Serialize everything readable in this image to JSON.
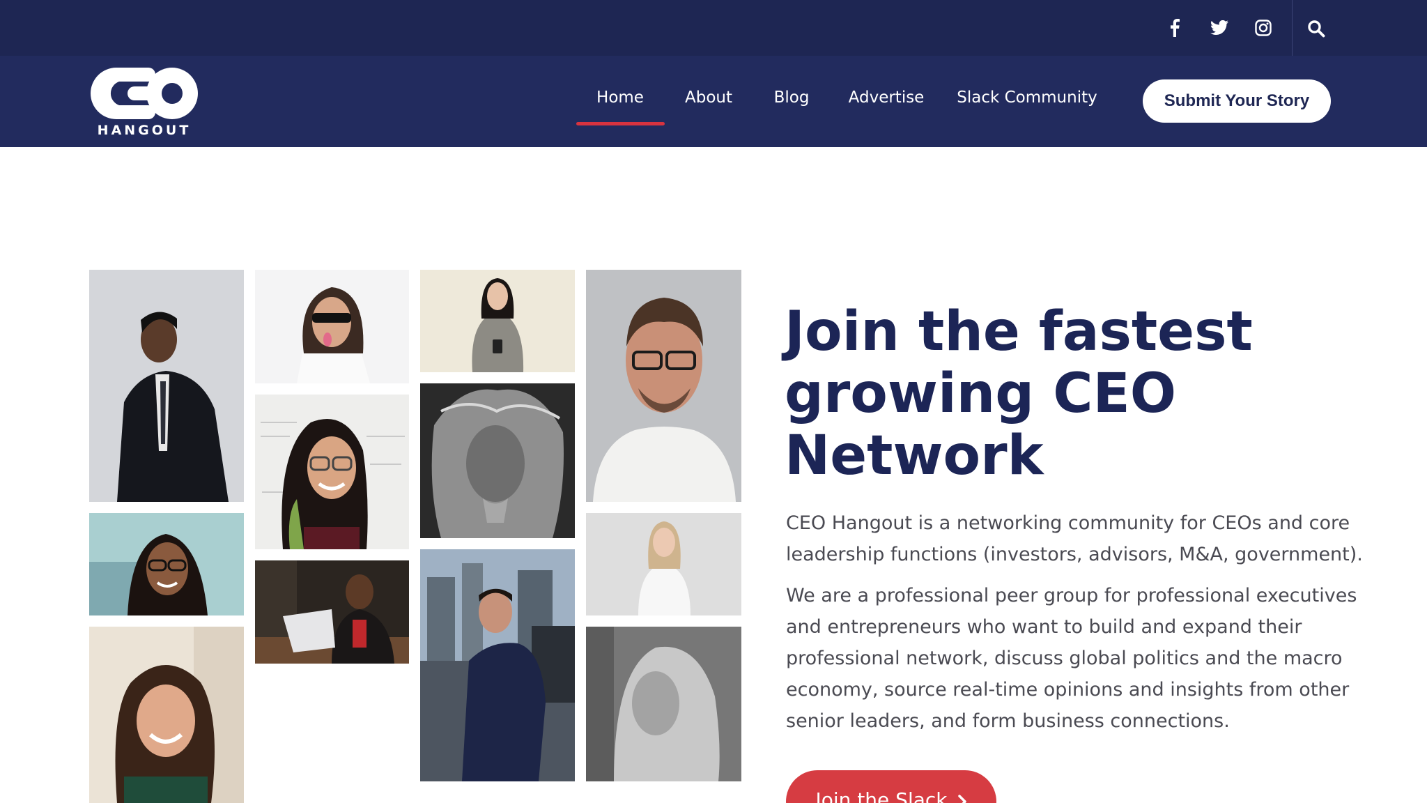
{
  "brand": {
    "logo_letters": "CEO",
    "logo_word": "HANGOUT"
  },
  "topbar": {
    "social_icons": [
      "facebook-icon",
      "twitter-icon",
      "instagram-icon"
    ],
    "search_icon": "search-icon"
  },
  "nav": {
    "items": [
      {
        "label": "Home",
        "active": true
      },
      {
        "label": "About"
      },
      {
        "label": "Blog"
      },
      {
        "label": "Advertise"
      },
      {
        "label": "Slack Community"
      }
    ],
    "submit_label": "Submit Your Story"
  },
  "hero": {
    "headline": [
      "Join the fastest",
      "growing CEO",
      "Network"
    ],
    "paragraph_1": "CEO Hangout is a networking community for CEOs and core leadership functions (investors, advisors, M&A, government).",
    "paragraph_2": "We are a professional peer group for professional executives and entrepreneurs who want to build and expand their professional network, discuss global politics and the macro economy, source real-time opinions and insights from other senior leaders, and form business connections.",
    "cta_label": "Join the Slack"
  },
  "colors": {
    "topbar": "#1e2653",
    "navbar": "#222b5e",
    "accent": "#d8333f",
    "headline": "#1c2556"
  }
}
